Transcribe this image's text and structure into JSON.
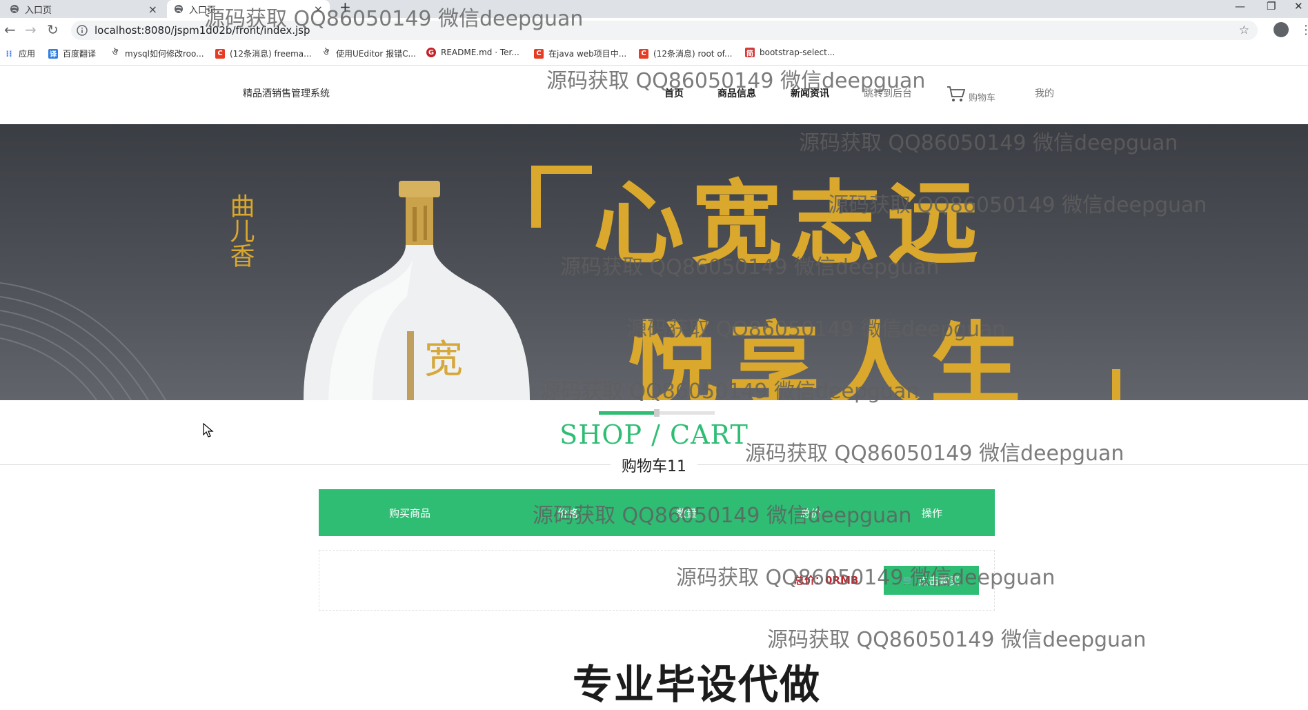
{
  "browser": {
    "tabs": [
      {
        "title": "入口页"
      },
      {
        "title": "入口页"
      }
    ],
    "url": "localhost:8080/jspm1d02b/front/index.jsp",
    "bookmarks": [
      {
        "label": "应用"
      },
      {
        "label": "百度翻译"
      },
      {
        "label": "mysql如何修改roo..."
      },
      {
        "label": "(12条消息) freema..."
      },
      {
        "label": "使用UEditor 报错C..."
      },
      {
        "label": "README.md · Ter..."
      },
      {
        "label": "在java web项目中..."
      },
      {
        "label": "(12条消息) root of..."
      },
      {
        "label": "bootstrap-select..."
      }
    ]
  },
  "site": {
    "logo": "精品酒销售管理系统",
    "nav": [
      {
        "label": "首页"
      },
      {
        "label": "商品信息"
      },
      {
        "label": "新闻资讯"
      },
      {
        "label": "跳转到后台"
      },
      {
        "label": "购物车"
      },
      {
        "label": "我的"
      }
    ]
  },
  "banner": {
    "brand_text": "曲儿香",
    "slogan_line1": "心宽志远",
    "slogan_line2": "悦享人生",
    "bottle_text": "宽"
  },
  "shop": {
    "title": "SHOP / CART",
    "subtitle": "购物车11",
    "columns": [
      "购买商品",
      "价格",
      "数量",
      "总价",
      "操作"
    ],
    "total": "总价：0RMB",
    "checkout_label": "点击购买"
  },
  "promo": "专业毕设代做",
  "watermark": "源码获取 QQ86050149 微信deepguan",
  "colors": {
    "accent_green": "#2fbd74",
    "total_red": "#c0262e",
    "banner_gold": "#d9a82c"
  }
}
